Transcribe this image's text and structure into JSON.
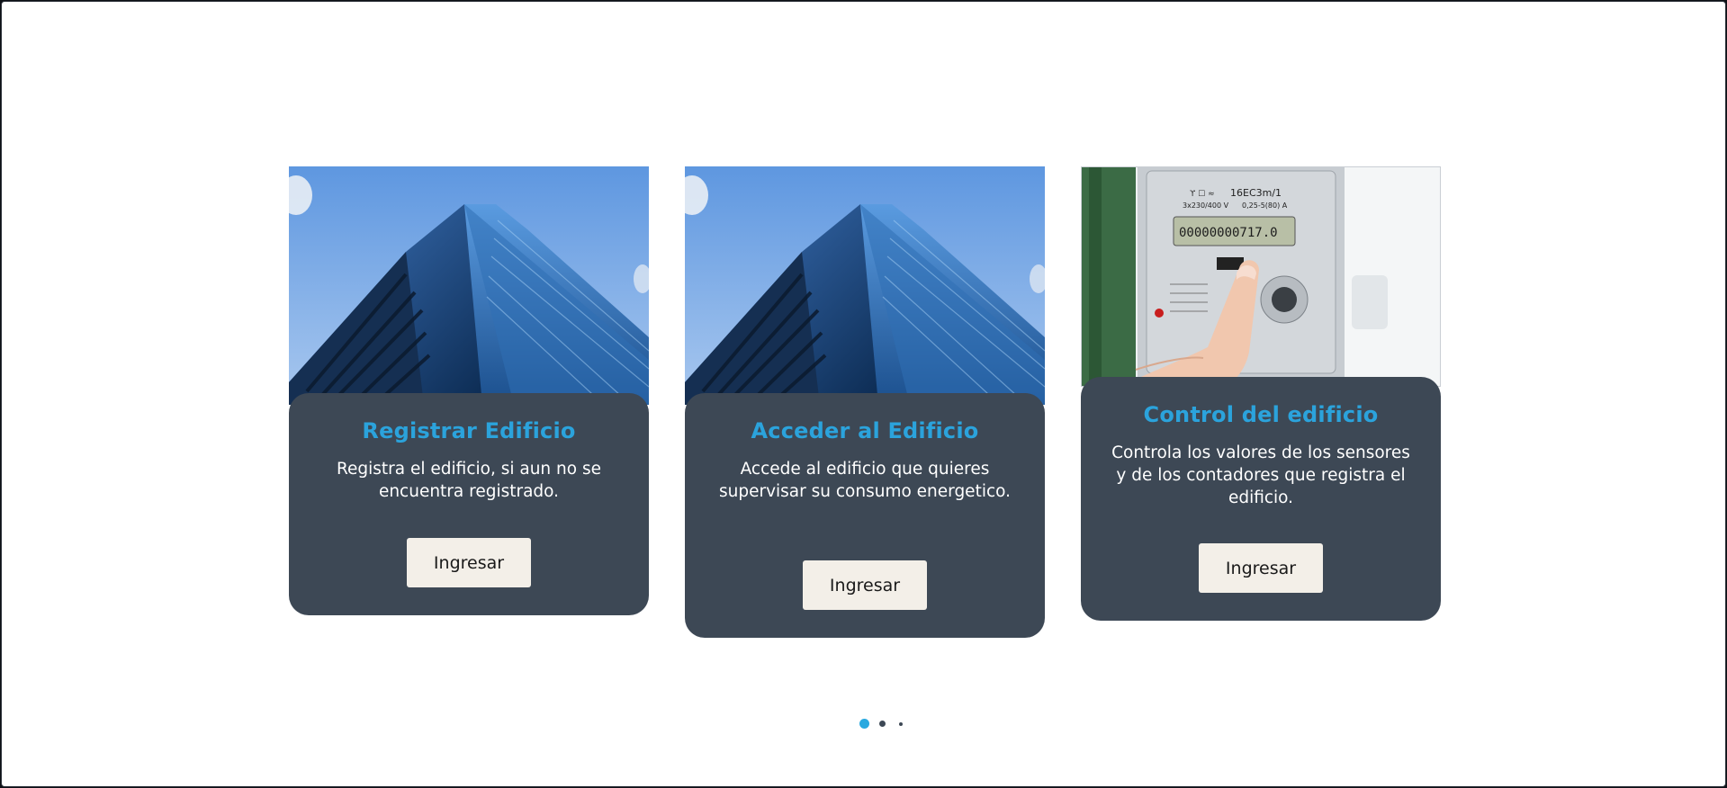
{
  "cards": [
    {
      "title": "Registrar Edificio",
      "description": "Registra el edificio, si aun no se encuentra registrado.",
      "button_label": "Ingresar",
      "image": "glass-skyscraper-photo"
    },
    {
      "title": "Acceder al Edificio",
      "description": "Accede al edificio que quieres supervisar su consumo energetico.",
      "button_label": "Ingresar",
      "image": "glass-skyscraper-photo"
    },
    {
      "title": "Control del edificio",
      "description": "Controla los valores de los sensores y de los contadores que registra el edificio.",
      "button_label": "Ingresar",
      "image": "electricity-meter-photo",
      "meter": {
        "brand_text": "16EC3m/1",
        "spec_line1": "3x230/400 V",
        "spec_line2": "0,25-5(80) A",
        "reading": "00000000717.0"
      }
    }
  ],
  "carousel": {
    "active_index": 0,
    "total": 3
  },
  "colors": {
    "card_body": "#3d4855",
    "title": "#2ba3dc",
    "button_bg": "#f3efe8",
    "dot_active": "#29a9e0",
    "dot_inactive": "#3d4855"
  }
}
